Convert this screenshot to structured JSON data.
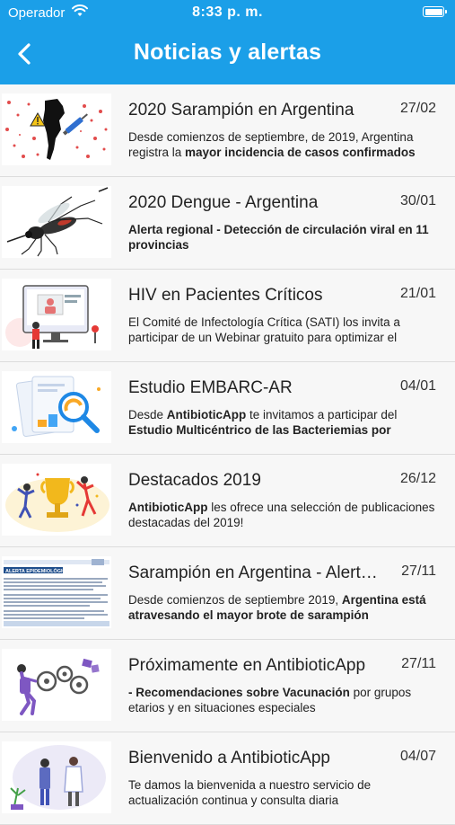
{
  "status_bar": {
    "carrier": "Operador",
    "time": "8:33 p. m."
  },
  "header": {
    "title": "Noticias y alertas",
    "back_icon": "chevron-left-icon"
  },
  "colors": {
    "header_bg": "#1b9fe8",
    "header_text": "#ffffff",
    "list_bg": "#f7f7f7",
    "divider": "#dcdcdc"
  },
  "news": [
    {
      "title": "2020 Sarampión en Argentina",
      "date": "27/02",
      "desc": [
        {
          "t": "Desde comienzos de septiembre, de 2019, Argentina registra la ",
          "b": false
        },
        {
          "t": "mayor incidencia de casos confirmados",
          "b": true
        }
      ]
    },
    {
      "title": "2020 Dengue - Argentina",
      "date": "30/01",
      "desc": [
        {
          "t": "Alerta regional - Detección de circulación viral en 11 provincias",
          "b": true
        }
      ]
    },
    {
      "title": "HIV en Pacientes Críticos",
      "date": "21/01",
      "desc": [
        {
          "t": "El Comité de Infectología Crítica (SATI) los invita a participar de un Webinar gratuito para optimizar el",
          "b": false
        }
      ]
    },
    {
      "title": "Estudio EMBARC-AR",
      "date": "04/01",
      "desc": [
        {
          "t": "Desde ",
          "b": false
        },
        {
          "t": "AntibioticApp",
          "b": true
        },
        {
          "t": " te invitamos a participar del ",
          "b": false
        },
        {
          "t": "Estudio Multicéntrico de las Bacteriemias por",
          "b": true
        }
      ]
    },
    {
      "title": "Destacados 2019",
      "date": "26/12",
      "desc": [
        {
          "t": "AntibioticApp",
          "b": true
        },
        {
          "t": " les ofrece una selección de publicaciones destacadas del 2019!",
          "b": false
        }
      ]
    },
    {
      "title": "Sarampión en Argentina - Alerta Epidemiológica",
      "date": "27/11",
      "desc": [
        {
          "t": "Desde comienzos de septiembre 2019, ",
          "b": false
        },
        {
          "t": "Argentina está atravesando el mayor brote de sarampión",
          "b": true
        }
      ]
    },
    {
      "title": "Próximamente en AntibioticApp",
      "date": "27/11",
      "desc": [
        {
          "t": "- Recomendaciones sobre Vacunación",
          "b": true
        },
        {
          "t": " por grupos etarios y en situaciones especiales",
          "b": false
        }
      ]
    },
    {
      "title": "Bienvenido a AntibioticApp",
      "date": "04/07",
      "desc": [
        {
          "t": "Te damos la bienvenida a nuestro servicio de actualización continua y consulta diaria",
          "b": false
        }
      ]
    }
  ],
  "thumbnails": [
    {
      "icon": "measles-map-icon"
    },
    {
      "icon": "mosquito-icon"
    },
    {
      "icon": "webinar-icon"
    },
    {
      "icon": "magnifier-chart-icon"
    },
    {
      "icon": "trophy-icon"
    },
    {
      "icon": "document-alert-icon",
      "text": "ALERTA EPIDEMIOLÓGICA"
    },
    {
      "icon": "gears-icon"
    },
    {
      "icon": "doctors-icon"
    }
  ]
}
